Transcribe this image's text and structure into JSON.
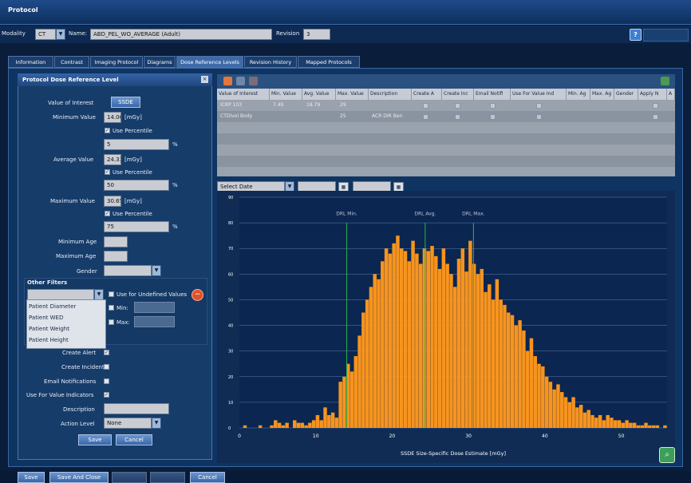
{
  "window": {
    "title": "Protocol"
  },
  "header": {
    "modality_label": "Modality",
    "modality_value": "CT",
    "name_label": "Name:",
    "name_value": "ABD_PEL_WO_AVERAGE (Adult)",
    "revision_label": "Revision",
    "revision_value": "3"
  },
  "tabs": [
    {
      "label": "Information",
      "active": false
    },
    {
      "label": "Contrast",
      "active": false
    },
    {
      "label": "Imaging Protocol",
      "active": false
    },
    {
      "label": "Diagrams",
      "active": false
    },
    {
      "label": "Dose Reference Levels",
      "active": true
    },
    {
      "label": "Revision History",
      "active": false
    },
    {
      "label": "Mapped Protocols",
      "active": false
    }
  ],
  "panel": {
    "title": "Protocol Dose Reference Level",
    "value_of_interest_label": "Value of Interest",
    "value_of_interest": "SSDE",
    "minimum_value_label": "Minimum Value",
    "minimum_value": "14.06",
    "unit": "[mGy]",
    "use_percentile_label": "Use Percentile",
    "percent_sign": "%",
    "minimum_percentile": "5",
    "average_value_label": "Average Value",
    "average_value": "24.33",
    "average_percentile": "50",
    "maximum_value_label": "Maximum Value",
    "maximum_value": "30.65",
    "maximum_percentile": "75",
    "minimum_age_label": "Minimum Age",
    "maximum_age_label": "Maximum Age",
    "gender_label": "Gender",
    "other_filters_label": "Other Filters",
    "use_undefined_label": "Use for Undefined Values",
    "min_label": "Min:",
    "max_label": "Max:",
    "filter_options": [
      "Patient Diameter",
      "Patient WED",
      "Patient Weight",
      "Patient Height"
    ],
    "create_alert_label": "Create Alert",
    "create_incident_label": "Create Incident",
    "email_notifications_label": "Email Notifications",
    "use_for_value_indicators_label": "Use For Value Indicators",
    "description_label": "Description",
    "action_level_label": "Action Level",
    "action_level_value": "None",
    "save_label": "Save",
    "cancel_label": "Cancel"
  },
  "grid": {
    "columns": [
      "Value of Interest",
      "Min. Value",
      "Avg. Value",
      "Max. Value",
      "Description",
      "Create A",
      "Create Inc",
      "Email Notifi",
      "Use For Value Ind",
      "Min. Ag",
      "Max. Ag",
      "Gender",
      "Apply N",
      "A"
    ],
    "rows": [
      {
        "voi": "ICRP 103",
        "min": "7.49",
        "avg": "18.79",
        "max": "29",
        "desc": ""
      },
      {
        "voi": "CTDIvol Body",
        "min": "",
        "avg": "",
        "max": "25",
        "desc": "ACR DIR Ben"
      }
    ]
  },
  "date_filter": {
    "select_label": "Select Date"
  },
  "chart_data": {
    "type": "bar",
    "title": "",
    "xlabel": "SSDE Size-Specific Dose Estimate [mGy]",
    "ylabel": "",
    "xlim": [
      0,
      56
    ],
    "ylim": [
      0,
      90
    ],
    "x_ticks": [
      0,
      10,
      20,
      30,
      40,
      50
    ],
    "y_ticks": [
      0,
      10,
      20,
      30,
      40,
      50,
      60,
      70,
      80,
      90
    ],
    "bin_width": 0.5,
    "bar_color": "#f7941e",
    "reference_line_color": "#2db34a",
    "reference_lines": [
      {
        "label": "DRL Min.",
        "x": 14.06
      },
      {
        "label": "DRL Avg.",
        "x": 24.33
      },
      {
        "label": "DRL Max.",
        "x": 30.65
      }
    ],
    "bins_start": [
      0.0,
      0.5,
      1.0,
      1.5,
      2.0,
      2.5,
      3.0,
      3.5,
      4.0,
      4.5,
      5.0,
      5.5,
      6.0,
      6.5,
      7.0,
      7.5,
      8.0,
      8.5,
      9.0,
      9.5,
      10.0,
      10.5,
      11.0,
      11.5,
      12.0,
      12.5,
      13.0,
      13.5,
      14.0,
      14.5,
      15.0,
      15.5,
      16.0,
      16.5,
      17.0,
      17.5,
      18.0,
      18.5,
      19.0,
      19.5,
      20.0,
      20.5,
      21.0,
      21.5,
      22.0,
      22.5,
      23.0,
      23.5,
      24.0,
      24.5,
      25.0,
      25.5,
      26.0,
      26.5,
      27.0,
      27.5,
      28.0,
      28.5,
      29.0,
      29.5,
      30.0,
      30.5,
      31.0,
      31.5,
      32.0,
      32.5,
      33.0,
      33.5,
      34.0,
      34.5,
      35.0,
      35.5,
      36.0,
      36.5,
      37.0,
      37.5,
      38.0,
      38.5,
      39.0,
      39.5,
      40.0,
      40.5,
      41.0,
      41.5,
      42.0,
      42.5,
      43.0,
      43.5,
      44.0,
      44.5,
      45.0,
      45.5,
      46.0,
      46.5,
      47.0,
      47.5,
      48.0,
      48.5,
      49.0,
      49.5,
      50.0,
      50.5,
      51.0,
      51.5,
      52.0,
      52.5,
      53.0,
      53.5,
      54.0,
      54.5,
      55.0,
      55.5
    ],
    "values": [
      0,
      1,
      0,
      0,
      0,
      1,
      0,
      0,
      1,
      3,
      2,
      1,
      2,
      0,
      3,
      2,
      2,
      1,
      2,
      3,
      5,
      3,
      8,
      5,
      6,
      4,
      18,
      20,
      25,
      22,
      28,
      36,
      45,
      50,
      55,
      60,
      58,
      65,
      70,
      68,
      72,
      75,
      70,
      69,
      65,
      73,
      68,
      64,
      70,
      69,
      71,
      67,
      62,
      70,
      64,
      60,
      55,
      66,
      70,
      61,
      73,
      64,
      60,
      62,
      53,
      56,
      50,
      58,
      50,
      48,
      45,
      44,
      40,
      42,
      38,
      30,
      35,
      28,
      25,
      24,
      20,
      18,
      15,
      17,
      14,
      12,
      10,
      12,
      8,
      9,
      6,
      7,
      5,
      4,
      5,
      3,
      5,
      4,
      3,
      3,
      2,
      3,
      2,
      2,
      1,
      1,
      2,
      1,
      1,
      1,
      0,
      1
    ]
  },
  "footer": {
    "save_label": "Save",
    "save_close_label": "Save And Close",
    "cancel_label": "Cancel"
  }
}
